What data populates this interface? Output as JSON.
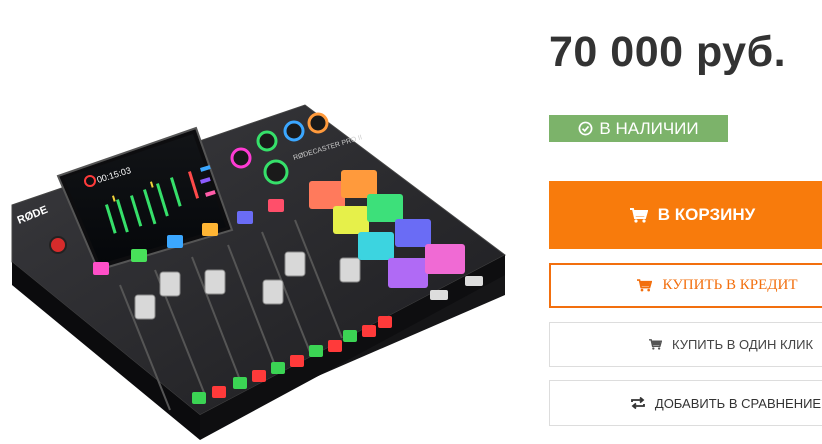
{
  "product": {
    "price": "70 000 руб.",
    "availability": "В НАЛИЧИИ",
    "device": {
      "brand": "RØDE",
      "model": "RØDECASTER PRO II",
      "timer": "00:15:03"
    }
  },
  "actions": {
    "add_to_cart": "В КОРЗИНУ",
    "buy_on_credit": "КУПИТЬ В КРЕДИТ",
    "buy_one_click": "КУПИТЬ В ОДИН КЛИК",
    "add_to_compare": "ДОБАВИТЬ В СРАВНЕНИЕ"
  },
  "colors": {
    "price": "#333333",
    "availability_bg": "#7cb36a",
    "primary": "#f87b0c",
    "credit": "#f26f0e",
    "pads": [
      "#ff7a5c",
      "#ff9a3c",
      "#e6f04a",
      "#3de07a",
      "#3cd4e0",
      "#6a6cf5",
      "#b06af5",
      "#f06ad4"
    ]
  },
  "icons": {
    "availability": "check-circle-icon",
    "cart": "cart-icon",
    "credit": "cart-icon",
    "one_click": "cart-icon",
    "compare": "compare-arrows-icon"
  }
}
